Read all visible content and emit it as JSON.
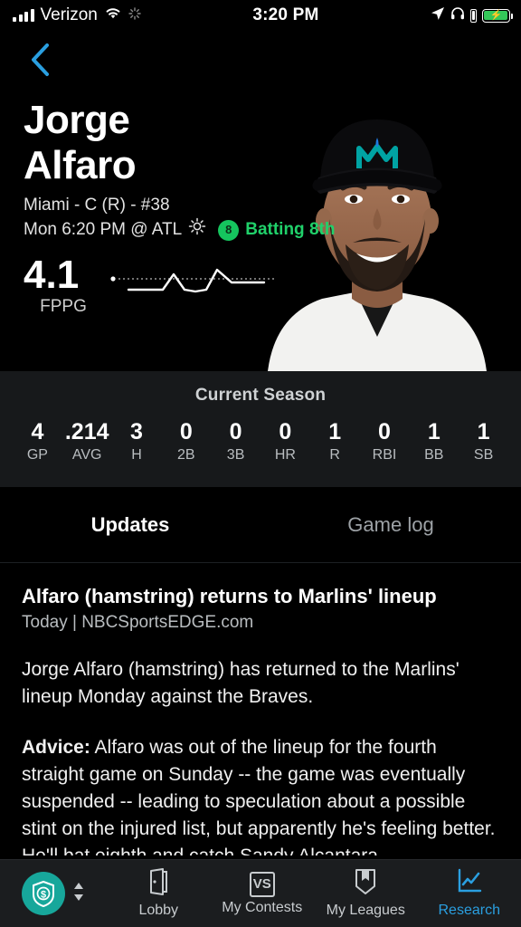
{
  "status_bar": {
    "carrier": "Verizon",
    "time": "3:20 PM",
    "icons": [
      "signal-bars-icon",
      "wifi-icon",
      "spinner-icon",
      "location-arrow-icon",
      "headphones-icon",
      "headphone-battery-icon",
      "battery-charging-icon"
    ]
  },
  "nav": {
    "back_icon": "chevron-left-icon",
    "back_color": "#2a9fe0"
  },
  "player": {
    "first_name": "Jorge",
    "last_name": "Alfaro",
    "team_position": "Miami - C (R) - #38",
    "game_time": "Mon 6:20 PM @ ATL",
    "weather_icon": "sun-icon",
    "batting_order": "8",
    "batting_label": "Batting 8th",
    "batting_color": "#20d16a",
    "fppg_value": "4.1",
    "fppg_label": "FPPG",
    "photo_alt": "player-headshot"
  },
  "season": {
    "title": "Current Season",
    "stats": [
      {
        "value": "4",
        "label": "GP"
      },
      {
        "value": ".214",
        "label": "AVG"
      },
      {
        "value": "3",
        "label": "H"
      },
      {
        "value": "0",
        "label": "2B"
      },
      {
        "value": "0",
        "label": "3B"
      },
      {
        "value": "0",
        "label": "HR"
      },
      {
        "value": "1",
        "label": "R"
      },
      {
        "value": "0",
        "label": "RBI"
      },
      {
        "value": "1",
        "label": "BB"
      },
      {
        "value": "1",
        "label": "SB"
      }
    ]
  },
  "tabs": [
    {
      "label": "Updates",
      "active": true
    },
    {
      "label": "Game log",
      "active": false
    }
  ],
  "article": {
    "headline": "Alfaro (hamstring) returns to Marlins' lineup",
    "byline": "Today | NBCSportsEDGE.com",
    "body": "Jorge Alfaro (hamstring) has returned to the Marlins' lineup Monday against the Braves.",
    "advice_label": "Advice:",
    "advice_body": " Alfaro was out of the lineup for the fourth straight game on Sunday -- the game was eventually suspended -- leading to speculation about a possible stint on the injured list, but apparently he's feeling better. He'll bat eighth and catch Sandy Alcantara."
  },
  "bottom_nav": {
    "wallet": {
      "icon": "shield-dollar-icon",
      "color": "#17a79b",
      "stepper_icon": "up-down-arrows-icon"
    },
    "items": [
      {
        "label": "Lobby",
        "icon": "door-icon",
        "active": false
      },
      {
        "label": "My Contests",
        "icon": "vs-icon",
        "active": false
      },
      {
        "label": "My Leagues",
        "icon": "banner-bookmark-icon",
        "active": false
      },
      {
        "label": "Research",
        "icon": "line-chart-icon",
        "active": true
      }
    ],
    "active_color": "#2a9fe0"
  },
  "chart_data": {
    "type": "line",
    "title": "FPPG sparkline",
    "x": [
      0,
      1,
      2,
      3,
      4,
      5,
      6,
      7,
      8,
      9
    ],
    "values": [
      0.0,
      0.0,
      0.0,
      4.6,
      1.0,
      0.6,
      6.2,
      2.4,
      2.4,
      2.4
    ],
    "xlabel": "",
    "ylabel": "",
    "grid": false,
    "baseline": 3.2
  }
}
